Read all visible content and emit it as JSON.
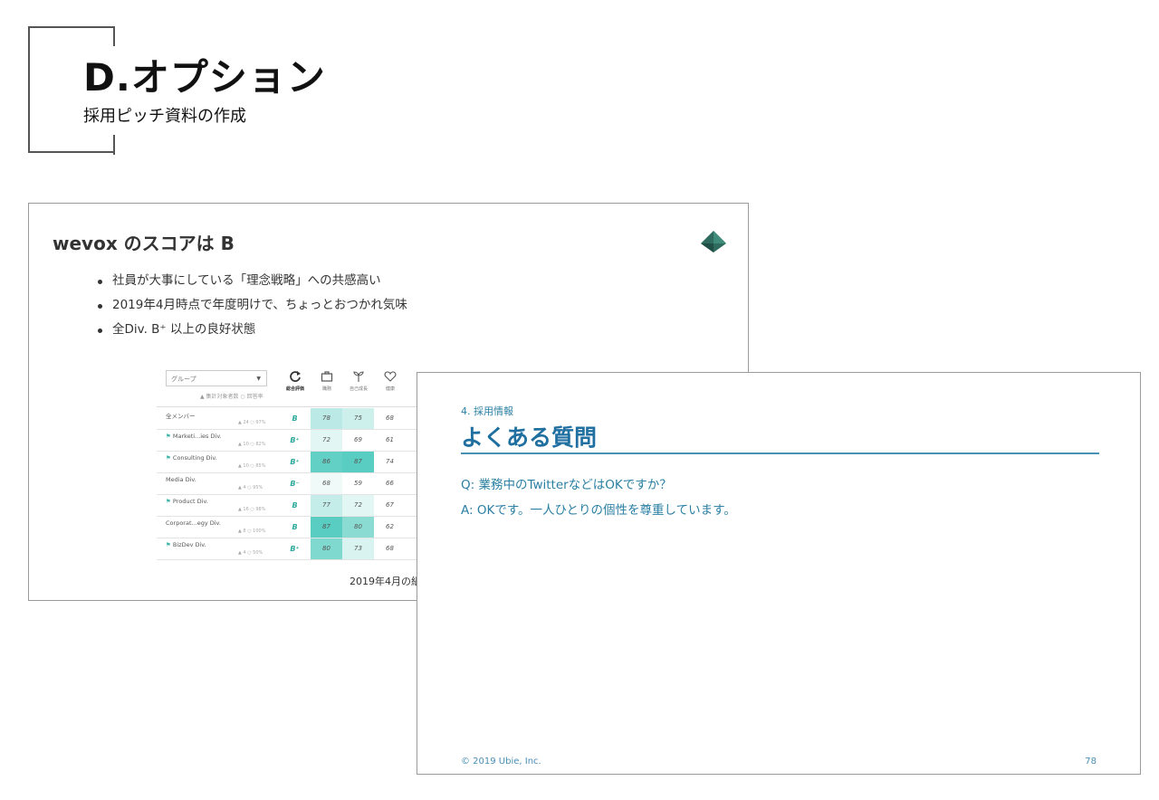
{
  "header": {
    "title": "D.オプション",
    "subtitle": "採用ピッチ資料の作成"
  },
  "slide1": {
    "title": "wevox のスコアは B",
    "bullets": [
      "社員が大事にしている「理念戦略」への共感高い",
      "2019年4月時点で年度明けで、ちょっとおつかれ気味",
      "全Div. B⁺ 以上の良好状態"
    ],
    "caption": "2019年4月の組",
    "table": {
      "group_select": "グループ",
      "legend": "▲ 集計対象者数  ○ 回答率",
      "columns": [
        "総合評価",
        "職務",
        "自己成長",
        "健康"
      ],
      "rows": [
        {
          "name": "全メンバー",
          "flag": false,
          "meta": "▲ 24 ○ 97%",
          "grade": "B",
          "v1": "78",
          "v2": "75",
          "v3": "68",
          "h1": 0.35,
          "h2": 0.25
        },
        {
          "name": "Marketi...ies Div.",
          "flag": true,
          "meta": "▲ 10 ○ 82%",
          "grade": "B⁺",
          "v1": "72",
          "v2": "69",
          "v3": "61",
          "h1": 0.15,
          "h2": 0.0
        },
        {
          "name": "Consulting Div.",
          "flag": true,
          "meta": "▲ 10 ○ 85%",
          "grade": "B⁺",
          "v1": "86",
          "v2": "87",
          "v3": "74",
          "h1": 0.8,
          "h2": 0.85
        },
        {
          "name": "Media Div.",
          "flag": false,
          "meta": "▲ 4 ○ 95%",
          "grade": "B⁻",
          "v1": "68",
          "v2": "59",
          "v3": "66",
          "h1": 0.05,
          "h2": 0.0
        },
        {
          "name": "Product Div.",
          "flag": true,
          "meta": "▲ 16 ○ 98%",
          "grade": "B",
          "v1": "77",
          "v2": "72",
          "v3": "67",
          "h1": 0.3,
          "h2": 0.15
        },
        {
          "name": "Corporat...egy Div.",
          "flag": false,
          "meta": "▲ 8 ○ 100%",
          "grade": "B",
          "v1": "87",
          "v2": "80",
          "v3": "62",
          "h1": 0.85,
          "h2": 0.6
        },
        {
          "name": "BizDev Div.",
          "flag": true,
          "meta": "▲ 4 ○ 50%",
          "grade": "B⁺",
          "v1": "80",
          "v2": "73",
          "v3": "68",
          "h1": 0.65,
          "h2": 0.2
        }
      ]
    }
  },
  "slide2": {
    "section": "4. 採用情報",
    "title": "よくある質問",
    "q": "Q: 業務中のTwitterなどはOKですか？",
    "a": "A: OKです。一人ひとりの個性を尊重しています。",
    "footer": "© 2019 Ubie, Inc.",
    "page": "78"
  },
  "colors": {
    "teal": "#3cc4b6",
    "accent_blue": "#1f6fa0",
    "frame": "#9a9a9a"
  }
}
